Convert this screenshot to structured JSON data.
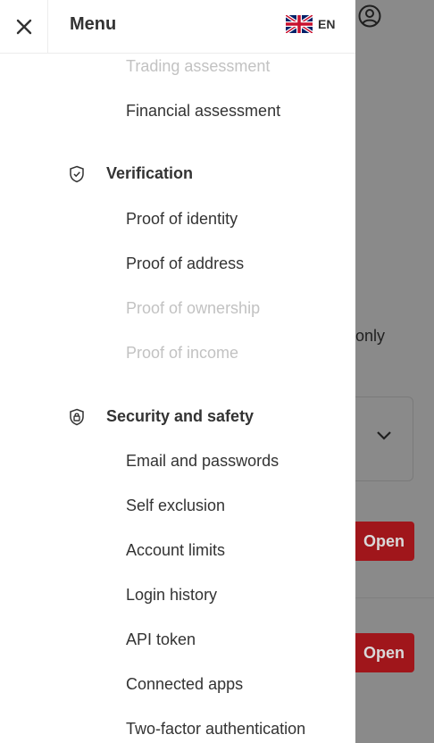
{
  "header": {
    "title": "Menu",
    "language": "EN",
    "icons": {
      "close": "close-icon",
      "flag": "uk-flag-icon"
    }
  },
  "menu": {
    "account_items": [
      {
        "label": "Trading assessment",
        "disabled": true
      },
      {
        "label": "Financial assessment",
        "disabled": false
      }
    ],
    "verification": {
      "label": "Verification",
      "icon": "shield-check-icon",
      "items": [
        {
          "label": "Proof of identity",
          "disabled": false
        },
        {
          "label": "Proof of address",
          "disabled": false
        },
        {
          "label": "Proof of ownership",
          "disabled": true
        },
        {
          "label": "Proof of income",
          "disabled": true
        }
      ]
    },
    "security": {
      "label": "Security and safety",
      "icon": "shield-lock-icon",
      "items": [
        {
          "label": "Email and passwords",
          "disabled": false
        },
        {
          "label": "Self exclusion",
          "disabled": false
        },
        {
          "label": "Account limits",
          "disabled": false
        },
        {
          "label": "Login history",
          "disabled": false
        },
        {
          "label": "API token",
          "disabled": false
        },
        {
          "label": "Connected apps",
          "disabled": false
        },
        {
          "label": "Two-factor authentication",
          "disabled": false
        }
      ]
    }
  },
  "background": {
    "partial_text": "only",
    "open_button_label": "Open",
    "colors": {
      "overlay": "#8a8a8a",
      "accent": "#a0161b"
    }
  }
}
